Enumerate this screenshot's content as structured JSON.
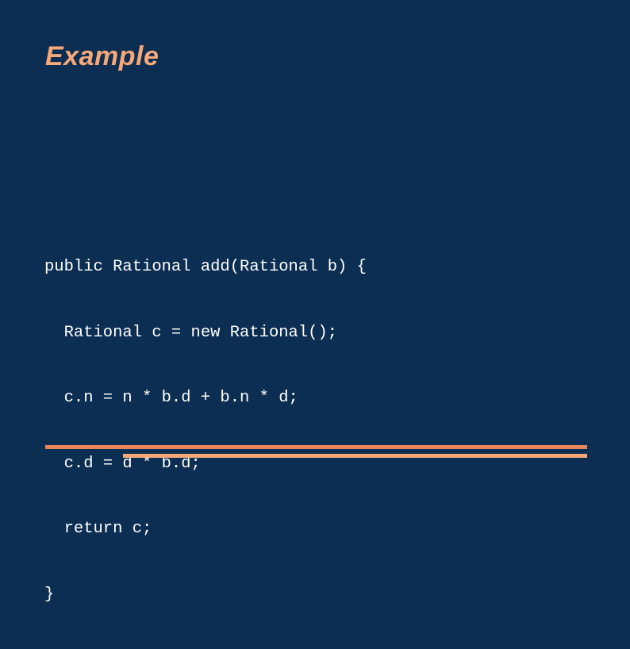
{
  "slide": {
    "title": "Example",
    "code_lines": [
      "public Rational add(Rational b) {",
      "  Rational c = new Rational();",
      "  c.n = n * b.d + b.n * d;",
      "  c.d = d * b.d;",
      "  return c;",
      "}"
    ],
    "colors": {
      "background": "#0b2e52",
      "title": "#f7a878",
      "code": "#ffffff",
      "rule_dark": "#e8855a",
      "rule_light": "#f7a878"
    }
  }
}
